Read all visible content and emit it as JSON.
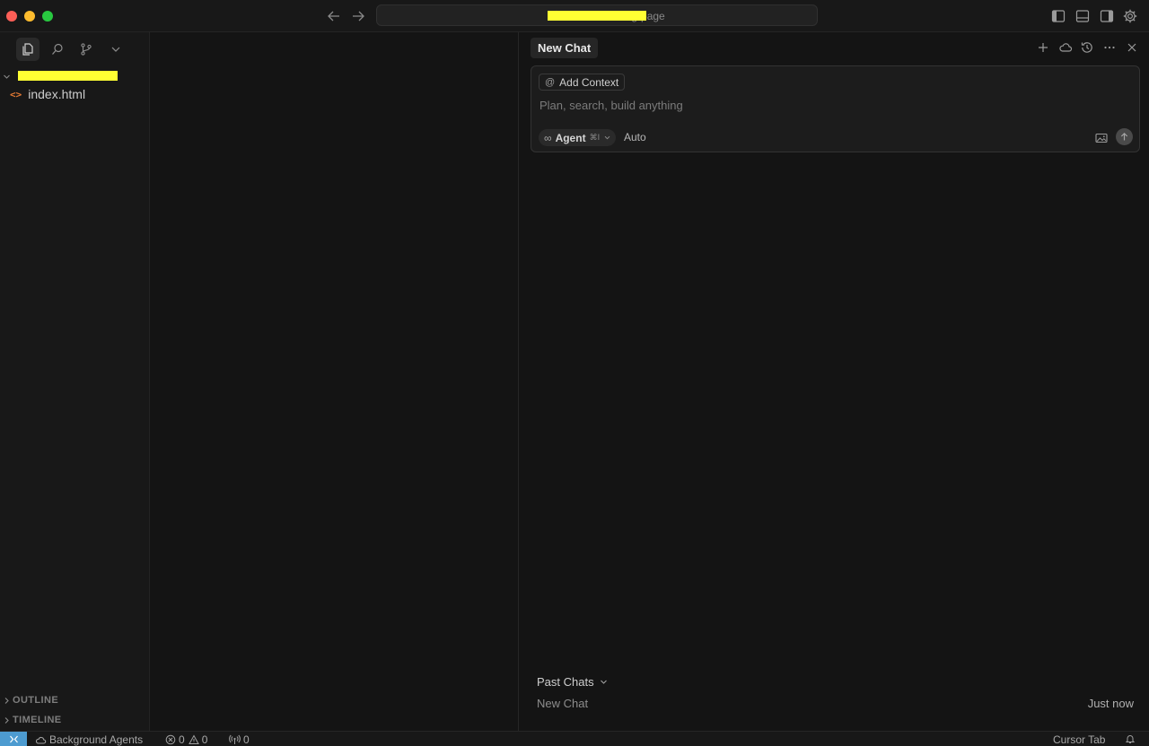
{
  "titlebar": {
    "command_center_text": "cursor-landing-page",
    "icons": [
      "back-arrow-icon",
      "forward-arrow-icon",
      "toggle-primary-sidebar-icon",
      "toggle-panel-icon",
      "toggle-secondary-sidebar-icon",
      "settings-gear-icon"
    ]
  },
  "sidebar": {
    "activity": [
      "explorer-files-icon",
      "search-icon",
      "source-control-icon",
      "more-views-chevron-icon"
    ],
    "folder_name": "",
    "files": [
      {
        "name": "index.html",
        "icon": "html-file-icon"
      }
    ],
    "sections": {
      "outline": "OUTLINE",
      "timeline": "TIMELINE"
    }
  },
  "chat": {
    "tab_label": "New Chat",
    "header_icons": [
      "new-chat-plus-icon",
      "cloud-icon",
      "history-icon",
      "more-ellipsis-icon",
      "close-icon"
    ],
    "add_context_label": "Add Context",
    "add_context_glyph": "@",
    "input_placeholder": "Plan, search, build anything",
    "agent_label": "Agent",
    "agent_shortcut": "⌘I",
    "model_label": "Auto",
    "past_chats_label": "Past Chats",
    "past_chats": [
      {
        "title": "New Chat",
        "time": "Just now"
      }
    ]
  },
  "statusbar": {
    "background_agents": "Background Agents",
    "errors": "0",
    "warnings": "0",
    "ports": "0",
    "cursor_tab": "Cursor Tab"
  },
  "colors": {
    "background": "#141414",
    "sidebar": "#181818",
    "remote_indicator": "#4d9bd0",
    "html_icon": "#e37933",
    "redaction": "#ffff33"
  }
}
